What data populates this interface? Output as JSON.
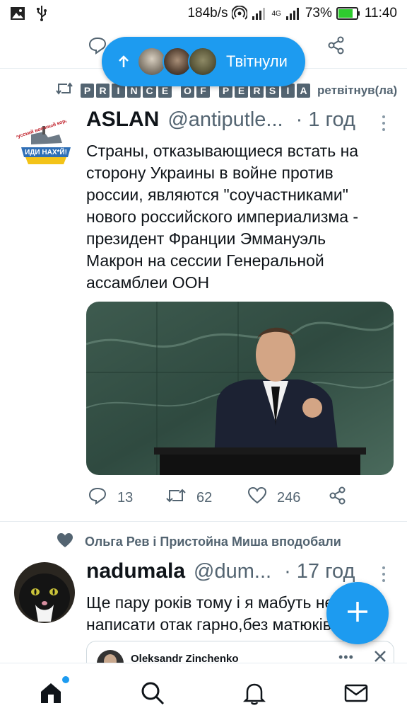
{
  "status_bar": {
    "net_speed": "184b/s",
    "network": "4G",
    "battery": "73%",
    "time": "11:40"
  },
  "pill": {
    "label": "Твітнули"
  },
  "tweet1": {
    "retweeter_letters": [
      "P",
      "R",
      "I",
      "N",
      "C",
      "E",
      "",
      "O",
      "F",
      "",
      "P",
      "E",
      "R",
      "S",
      "I",
      "A"
    ],
    "retweet_suffix": "ретвітнув(ла)",
    "avatar_text_top": "Русский военный корабль",
    "avatar_text_bottom": "ИДИ НАХ*Й!",
    "name": "ASLAN",
    "handle": "@antiputle...",
    "time": "· 1 год",
    "text": "Страны, отказывающиеся встать на сторону Украины в войне против россии, являются \"соучастниками\" нового российского империализма - президент Франции Эммануэль Макрон на сессии Генеральной ассамблеи ООН",
    "replies": "13",
    "retweets": "62",
    "likes": "246"
  },
  "tweet2": {
    "liked_by": "Ольга Рев і Пристойна Миша вподобали",
    "name": "nadumala",
    "handle": "@dum...",
    "time": "· 17 год",
    "text_line1": "Ще пару років тому і я мабуть не",
    "text_line2": "написати отак гарно,без матюків",
    "quote_name": "Oleksandr Zinchenko"
  },
  "colors": {
    "accent": "#1d9bf0",
    "secondary_text": "#536471",
    "primary_text": "#0f1419"
  },
  "icons": [
    "image-icon",
    "usb-icon",
    "hotspot-icon",
    "signal-icon",
    "battery-icon",
    "reply-icon",
    "share-icon",
    "arrow-up-icon",
    "retweet-icon",
    "kebab-icon",
    "like-icon",
    "heart-filled-icon",
    "plus-icon",
    "home-icon",
    "search-icon",
    "bell-icon",
    "mail-icon",
    "close-icon"
  ]
}
